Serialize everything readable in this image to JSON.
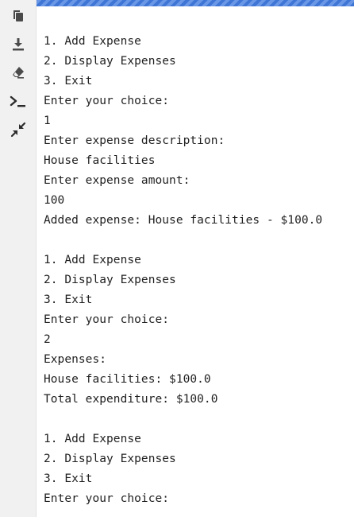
{
  "sidebar": {
    "tools": [
      {
        "icon": "copy-icon"
      },
      {
        "icon": "download-icon"
      },
      {
        "icon": "eraser-icon"
      },
      {
        "icon": "terminal-icon"
      },
      {
        "icon": "collapse-icon"
      }
    ]
  },
  "colors": {
    "accent_stripe": "#3f76d6",
    "sidebar_bg": "#f1f1f1",
    "text": "#1f1f1f"
  },
  "console": {
    "lines": [
      "1. Add Expense",
      "2. Display Expenses",
      "3. Exit",
      "Enter your choice:",
      "1",
      "Enter expense description:",
      "House facilities",
      "Enter expense amount:",
      "100",
      "Added expense: House facilities - $100.0",
      "",
      "1. Add Expense",
      "2. Display Expenses",
      "3. Exit",
      "Enter your choice:",
      "2",
      "Expenses:",
      "House facilities: $100.0",
      "Total expenditure: $100.0",
      "",
      "1. Add Expense",
      "2. Display Expenses",
      "3. Exit",
      "Enter your choice:"
    ]
  }
}
